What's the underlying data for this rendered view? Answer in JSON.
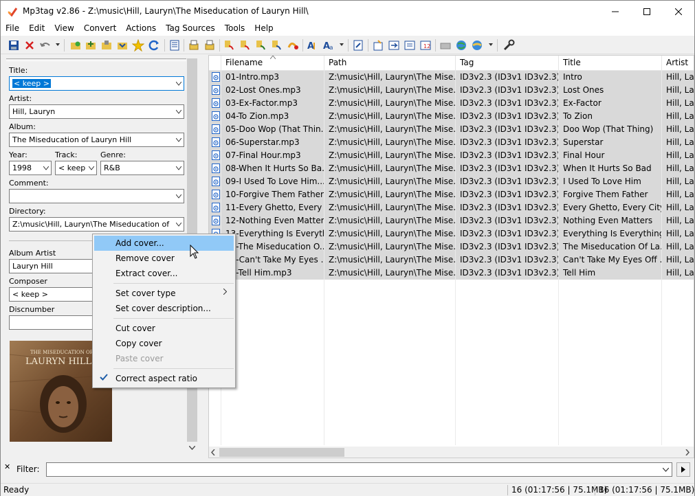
{
  "window": {
    "title": "Mp3tag v2.86  -  Z:\\music\\Hill, Lauryn\\The Miseducation of Lauryn Hill\\"
  },
  "menu": [
    "File",
    "Edit",
    "View",
    "Convert",
    "Actions",
    "Tag Sources",
    "Tools",
    "Help"
  ],
  "tag_panel": {
    "title_label": "Title:",
    "title_value": "< keep >",
    "artist_label": "Artist:",
    "artist_value": "Hill, Lauryn",
    "album_label": "Album:",
    "album_value": "The Miseducation of Lauryn Hill",
    "year_label": "Year:",
    "year_value": "1998",
    "track_label": "Track:",
    "track_value": "< keep",
    "genre_label": "Genre:",
    "genre_value": "R&B",
    "comment_label": "Comment:",
    "comment_value": "",
    "directory_label": "Directory:",
    "directory_value": "Z:\\music\\Hill, Lauryn\\The Miseducation of Lauryn Hill",
    "album_artist_label": "Album Artist",
    "album_artist_value": "Lauryn Hill",
    "composer_label": "Composer",
    "composer_value": "< keep >",
    "discnumber_label": "Discnumber",
    "discnumber_value": "",
    "cover_line1": "THE MISEDUCATION OF",
    "cover_line2": "LAURYN HILL"
  },
  "file_list": {
    "columns": [
      "Filename",
      "Path",
      "Tag",
      "Title",
      "Artist"
    ],
    "rows": [
      {
        "filename": "01-Intro.mp3",
        "path": "Z:\\music\\Hill, Lauryn\\The Mise...",
        "tag": "ID3v2.3 (ID3v1 ID3v2.3)",
        "title": "Intro",
        "artist": "Hill, Lau"
      },
      {
        "filename": "02-Lost Ones.mp3",
        "path": "Z:\\music\\Hill, Lauryn\\The Mise...",
        "tag": "ID3v2.3 (ID3v1 ID3v2.3)",
        "title": "Lost Ones",
        "artist": "Hill, Lau"
      },
      {
        "filename": "03-Ex-Factor.mp3",
        "path": "Z:\\music\\Hill, Lauryn\\The Mise...",
        "tag": "ID3v2.3 (ID3v1 ID3v2.3)",
        "title": "Ex-Factor",
        "artist": "Hill, Lau"
      },
      {
        "filename": "04-To Zion.mp3",
        "path": "Z:\\music\\Hill, Lauryn\\The Mise...",
        "tag": "ID3v2.3 (ID3v1 ID3v2.3)",
        "title": "To Zion",
        "artist": "Hill, Lau"
      },
      {
        "filename": "05-Doo Wop (That Thin...",
        "path": "Z:\\music\\Hill, Lauryn\\The Mise...",
        "tag": "ID3v2.3 (ID3v1 ID3v2.3)",
        "title": "Doo Wop (That Thing)",
        "artist": "Hill, Lau"
      },
      {
        "filename": "06-Superstar.mp3",
        "path": "Z:\\music\\Hill, Lauryn\\The Mise...",
        "tag": "ID3v2.3 (ID3v1 ID3v2.3)",
        "title": "Superstar",
        "artist": "Hill, Lau"
      },
      {
        "filename": "07-Final Hour.mp3",
        "path": "Z:\\music\\Hill, Lauryn\\The Mise...",
        "tag": "ID3v2.3 (ID3v1 ID3v2.3)",
        "title": "Final Hour",
        "artist": "Hill, Lau"
      },
      {
        "filename": "08-When It Hurts So Ba...",
        "path": "Z:\\music\\Hill, Lauryn\\The Mise...",
        "tag": "ID3v2.3 (ID3v1 ID3v2.3)",
        "title": "When It Hurts So Bad",
        "artist": "Hill, Lau"
      },
      {
        "filename": "09-I Used To Love Him....",
        "path": "Z:\\music\\Hill, Lauryn\\The Mise...",
        "tag": "ID3v2.3 (ID3v1 ID3v2.3)",
        "title": "I Used To Love Him",
        "artist": "Hill, Lau"
      },
      {
        "filename": "10-Forgive Them Father...",
        "path": "Z:\\music\\Hill, Lauryn\\The Mise...",
        "tag": "ID3v2.3 (ID3v1 ID3v2.3)",
        "title": "Forgive Them Father",
        "artist": "Hill, Lau"
      },
      {
        "filename": "11-Every Ghetto, Every ...",
        "path": "Z:\\music\\Hill, Lauryn\\The Mise...",
        "tag": "ID3v2.3 (ID3v1 ID3v2.3)",
        "title": "Every Ghetto, Every City",
        "artist": "Hill, Lau"
      },
      {
        "filename": "12-Nothing Even Matter...",
        "path": "Z:\\music\\Hill, Lauryn\\The Mise...",
        "tag": "ID3v2.3 (ID3v1 ID3v2.3)",
        "title": "Nothing Even Matters",
        "artist": "Hill, Lau"
      },
      {
        "filename": "13-Everything Is Everyth...",
        "path": "Z:\\music\\Hill, Lauryn\\The Mise...",
        "tag": "ID3v2.3 (ID3v1 ID3v2.3)",
        "title": "Everything Is Everything",
        "artist": "Hill, Lau"
      },
      {
        "filename": "14-The Miseducation O...",
        "path": "Z:\\music\\Hill, Lauryn\\The Mise...",
        "tag": "ID3v2.3 (ID3v1 ID3v2.3)",
        "title": "The Miseducation Of La...",
        "artist": "Hill, Lau"
      },
      {
        "filename": "15-Can't Take My Eyes ...",
        "path": "Z:\\music\\Hill, Lauryn\\The Mise...",
        "tag": "ID3v2.3 (ID3v1 ID3v2.3)",
        "title": "Can't Take My Eyes Off ...",
        "artist": "Hill, Lau"
      },
      {
        "filename": "16-Tell Him.mp3",
        "path": "Z:\\music\\Hill, Lauryn\\The Mise...",
        "tag": "ID3v2.3 (ID3v1 ID3v2.3)",
        "title": "Tell Him",
        "artist": "Hill, Lau"
      }
    ]
  },
  "context_menu": {
    "add_cover": "Add cover...",
    "remove_cover": "Remove cover",
    "extract_cover": "Extract cover...",
    "set_cover_type": "Set cover type",
    "set_cover_description": "Set cover description...",
    "cut_cover": "Cut cover",
    "copy_cover": "Copy cover",
    "paste_cover": "Paste cover",
    "correct_aspect_ratio": "Correct aspect ratio"
  },
  "filter": {
    "label": "Filter:",
    "value": ""
  },
  "status": {
    "text": "Ready",
    "selected": "16 (01:17:56 | 75.1MB)",
    "total": "16 (01:17:56 | 75.1MB)"
  },
  "colors": {
    "selection_row": "#d9d9d9",
    "menu_highlight": "#91c9f7",
    "focus_blue": "#0078d7"
  }
}
